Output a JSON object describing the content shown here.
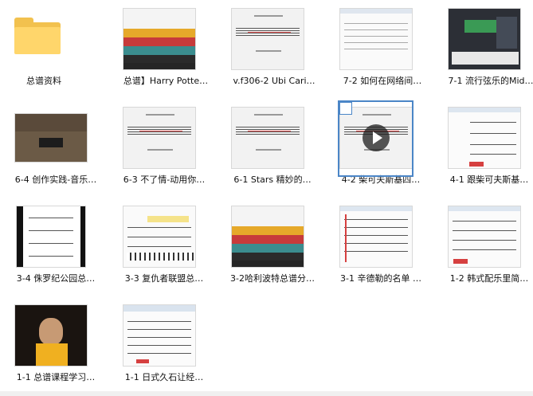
{
  "files": [
    {
      "label": "总谱资料"
    },
    {
      "label": "总谱】Harry Potte…"
    },
    {
      "label": "v.f306-2 Ubi Cari…"
    },
    {
      "label": "7-2 如何在网络间…"
    },
    {
      "label": "7-1 流行弦乐的Mid…"
    },
    {
      "label": "6-4 创作实践-音乐…"
    },
    {
      "label": "6-3 不了情-动用你…"
    },
    {
      "label": "6-1 Stars 精妙的…"
    },
    {
      "label": "4-2 柴可夫斯基四…"
    },
    {
      "label": "4-1 跟柴可夫斯基…"
    },
    {
      "label": "3-4 侏罗纪公园总…"
    },
    {
      "label": "3-3 复仇者联盟总…"
    },
    {
      "label": "3-2哈利波特总谱分…"
    },
    {
      "label": "3-1 辛德勒的名单 …"
    },
    {
      "label": "1-2 韩式配乐里简…"
    },
    {
      "label": "1-1 总谱课程学习…"
    },
    {
      "label": "1-1 日式久石让经…"
    }
  ],
  "colors": {
    "selection": "#4b86c7",
    "folder": "#f2c14e"
  }
}
